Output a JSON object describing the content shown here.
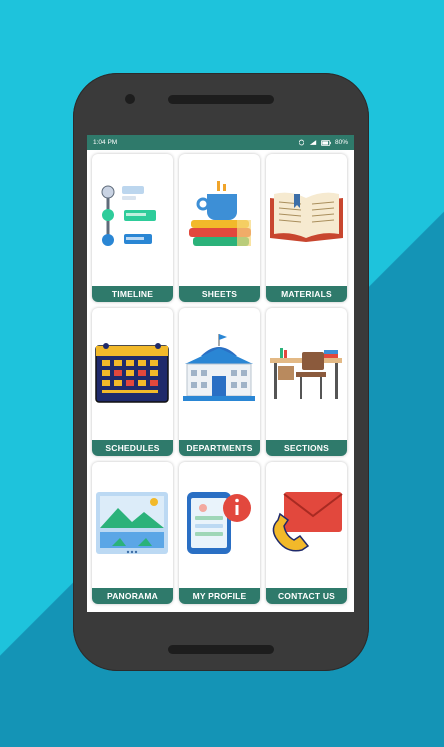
{
  "status_bar": {
    "time": "1:04 PM",
    "battery": "80%",
    "icons": [
      "sync-icon",
      "signal-icon",
      "battery-icon"
    ]
  },
  "menu": {
    "items": [
      {
        "label": "TIMELINE",
        "icon": "timeline-icon"
      },
      {
        "label": "SHEETS",
        "icon": "books-coffee-icon"
      },
      {
        "label": "MATERIALS",
        "icon": "open-book-icon"
      },
      {
        "label": "SCHEDULES",
        "icon": "calendar-icon"
      },
      {
        "label": "DEPARTMENTS",
        "icon": "school-building-icon"
      },
      {
        "label": "SECTIONS",
        "icon": "desk-chair-icon"
      },
      {
        "label": "PANORAMA",
        "icon": "panorama-image-icon"
      },
      {
        "label": "MY PROFILE",
        "icon": "phone-profile-info-icon"
      },
      {
        "label": "CONTACT US",
        "icon": "phone-mail-icon"
      }
    ]
  },
  "colors": {
    "background": "#1ec3dc",
    "phone": "#3a3a3a",
    "accent": "#2f7a6b"
  }
}
